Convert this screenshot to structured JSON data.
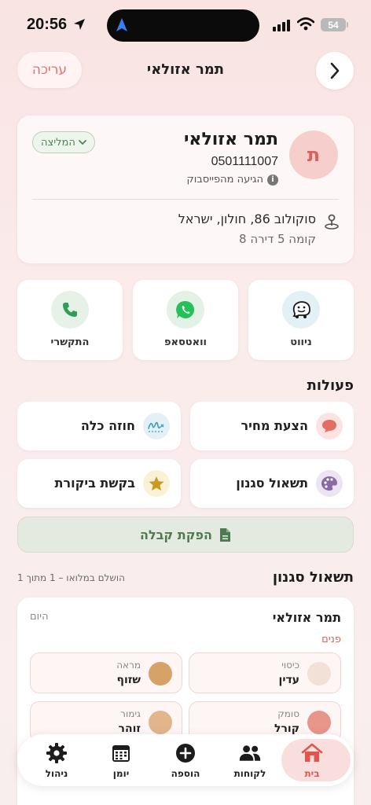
{
  "status_bar": {
    "time": "20:56",
    "battery": "54"
  },
  "header": {
    "edit_label": "עריכה",
    "title": "תמר אזולאי"
  },
  "client": {
    "avatar_letter": "ת",
    "name": "תמר אזולאי",
    "phone": "0501111007",
    "source": "הגיעה מהפייסבוק",
    "badge": "המליצה",
    "address": "סוקולוב 86, חולון, ישראל",
    "address_detail": "קומה 5 דירה 8"
  },
  "contact": {
    "waze": "ניווט",
    "whatsapp": "וואטסאפ",
    "call": "התקשרי"
  },
  "actions": {
    "title": "פעולות",
    "quote": "הצעת מחיר",
    "contract": "חוזה כלה",
    "stylist_form": "תשאול סגנון",
    "review": "בקשת ביקורת",
    "receipt": "הפקת קבלה"
  },
  "questionnaire": {
    "title": "תשאול סגנון",
    "status": "הושלם במלואו – 1 מתוך 1",
    "client_name": "תמר אזולאי",
    "date": "היום",
    "section": "פנים",
    "items": [
      {
        "category": "כיסוי",
        "value": "עדין",
        "color": "#f1e1d6"
      },
      {
        "category": "מראה",
        "value": "שזוף",
        "color": "#d6a268"
      },
      {
        "category": "סומק",
        "value": "קורל",
        "color": "#e8958a"
      },
      {
        "category": "גימור",
        "value": "זוהר",
        "color": "#e3b58c"
      }
    ]
  },
  "tabs": {
    "home": "בית",
    "clients": "לקוחות",
    "add": "הוספה",
    "calendar": "יומן",
    "manage": "ניהול"
  },
  "colors": {
    "accent": "#e0564e",
    "green": "#4d8651",
    "whatsapp": "#25c05a",
    "call": "#2f9e57"
  }
}
